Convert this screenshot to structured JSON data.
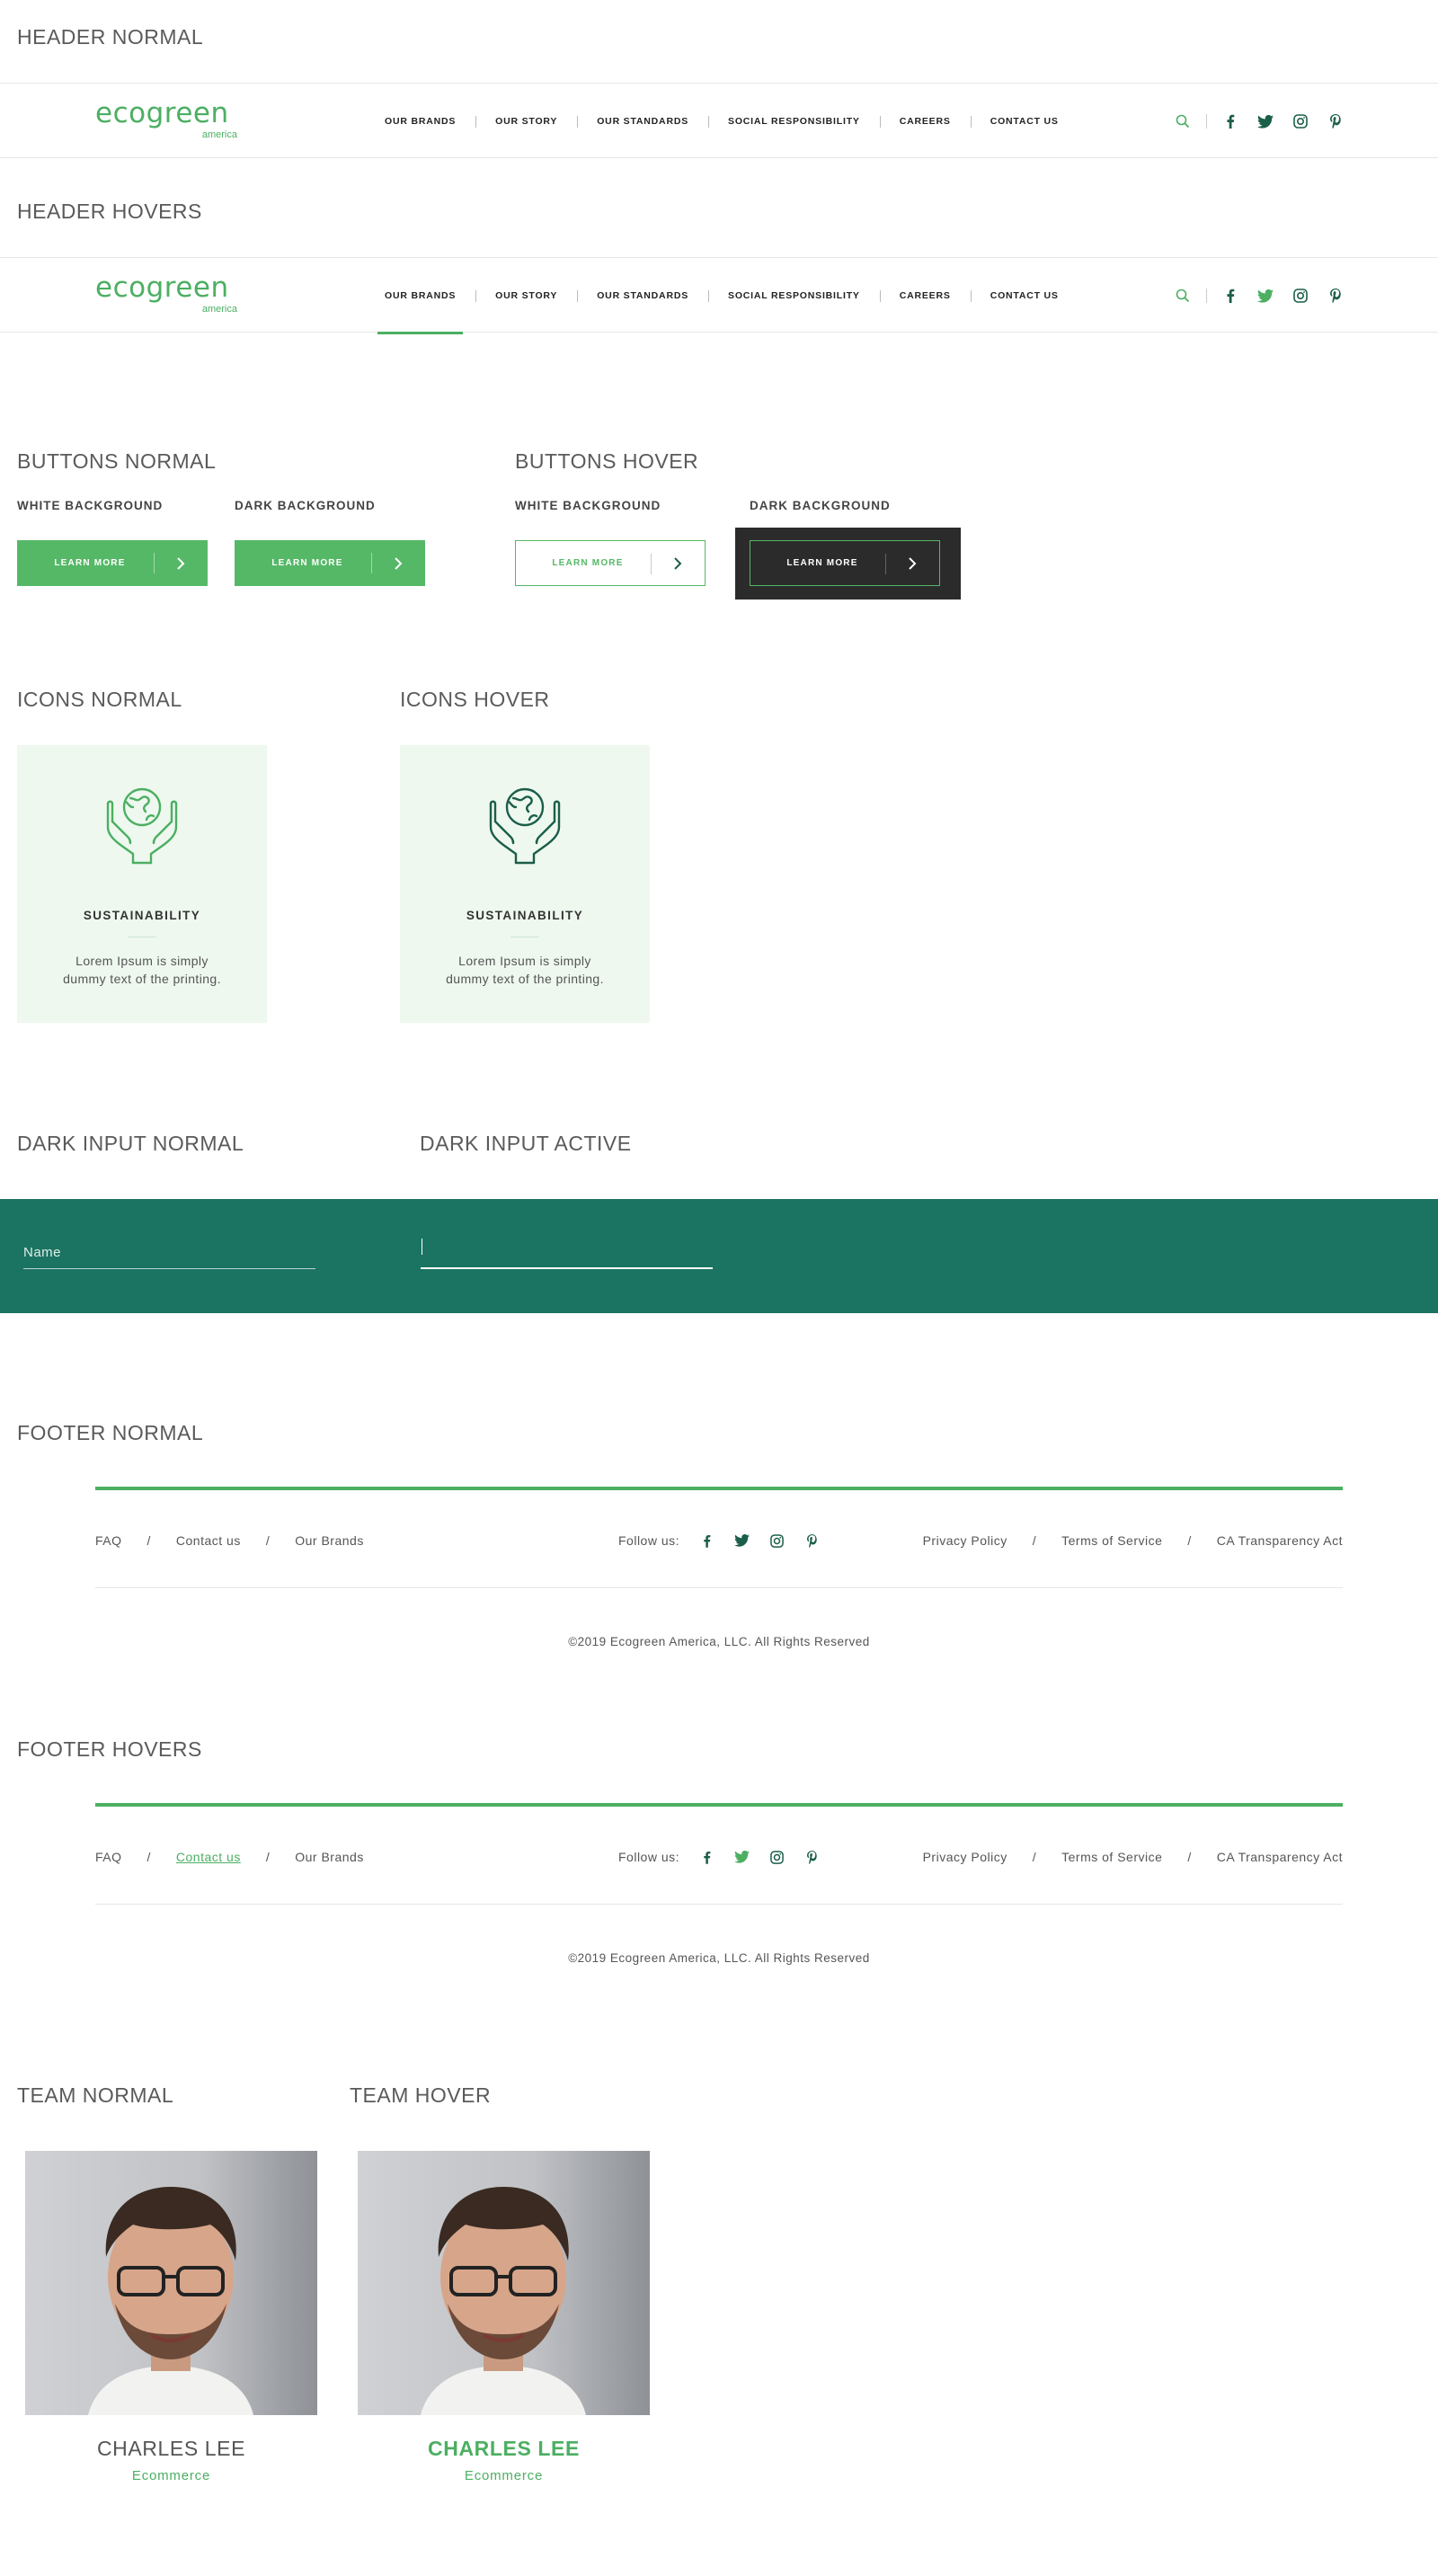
{
  "sections": {
    "header_normal": "HEADER NORMAL",
    "header_hovers": "HEADER HOVERS",
    "buttons_normal": "BUTTONS NORMAL",
    "buttons_hover": "BUTTONS HOVER",
    "icons_normal": "ICONS NORMAL",
    "icons_hover": "ICONS HOVER",
    "dark_input_normal": "DARK INPUT NORMAL",
    "dark_input_active": "DARK INPUT ACTIVE",
    "footer_normal": "FOOTER NORMAL",
    "footer_hovers": "FOOTER HOVERS",
    "team_normal": "TEAM NORMAL",
    "team_hover": "TEAM HOVER"
  },
  "logo": {
    "word": "ecogreen",
    "sub": "america"
  },
  "nav": [
    "OUR BRANDS",
    "OUR STORY",
    "OUR STANDARDS",
    "SOCIAL RESPONSIBILITY",
    "CAREERS",
    "CONTACT US"
  ],
  "header_icons": [
    "search-icon",
    "facebook-icon",
    "twitter-icon",
    "instagram-icon",
    "pinterest-icon"
  ],
  "buttons": {
    "white_bg": "WHITE BACKGROUND",
    "dark_bg": "DARK BACKGROUND",
    "label": "LEARN MORE"
  },
  "icon_card": {
    "title": "SUSTAINABILITY",
    "desc": "Lorem Ipsum is simply dummy text of the printing.",
    "icon": "hands-globe-icon"
  },
  "dark_input": {
    "placeholder": "Name",
    "value": ""
  },
  "footer": {
    "links": [
      "FAQ",
      "Contact us",
      "Our Brands"
    ],
    "follow": "Follow us:",
    "legal": [
      "Privacy Policy",
      "Terms of Service",
      "CA Transparency Act"
    ],
    "copyright": "©2019 Ecogreen America, LLC. All Rights Reserved"
  },
  "team": {
    "name": "CHARLES LEE",
    "role": "Ecommerce"
  },
  "colors": {
    "brand_green": "#4caf62",
    "dark_teal": "#1b7461",
    "icon_hover": "#1b5e4a",
    "dark_panel": "#2b2b2b",
    "card_bg": "#eef8ef"
  }
}
